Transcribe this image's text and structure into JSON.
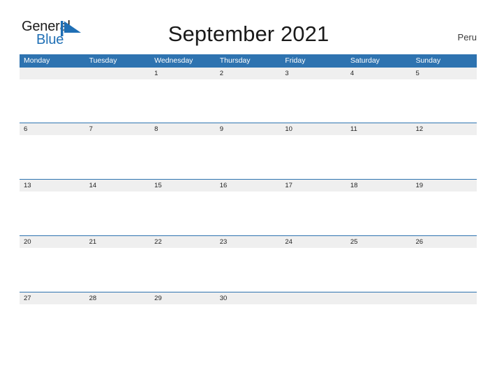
{
  "logo": {
    "word_one": "General",
    "word_two": "Blue",
    "flag_icon": "blue-flag-triangle-icon",
    "colors": {
      "dark": "#1a1a1a",
      "blue": "#1f6fb5"
    }
  },
  "header": {
    "title": "September 2021",
    "country": "Peru"
  },
  "theme": {
    "header_blue": "#2e73b0",
    "strip_gray": "#efefef",
    "page_background": "#ffffff",
    "text_dark": "#1f1f1f"
  },
  "calendar": {
    "month": "September",
    "year": "2021",
    "weekday_headers": [
      "Monday",
      "Tuesday",
      "Wednesday",
      "Thursday",
      "Friday",
      "Saturday",
      "Sunday"
    ],
    "weeks": [
      [
        "",
        "",
        "1",
        "2",
        "3",
        "4",
        "5"
      ],
      [
        "6",
        "7",
        "8",
        "9",
        "10",
        "11",
        "12"
      ],
      [
        "13",
        "14",
        "15",
        "16",
        "17",
        "18",
        "19"
      ],
      [
        "20",
        "21",
        "22",
        "23",
        "24",
        "25",
        "26"
      ],
      [
        "27",
        "28",
        "29",
        "30",
        "",
        "",
        ""
      ]
    ]
  }
}
